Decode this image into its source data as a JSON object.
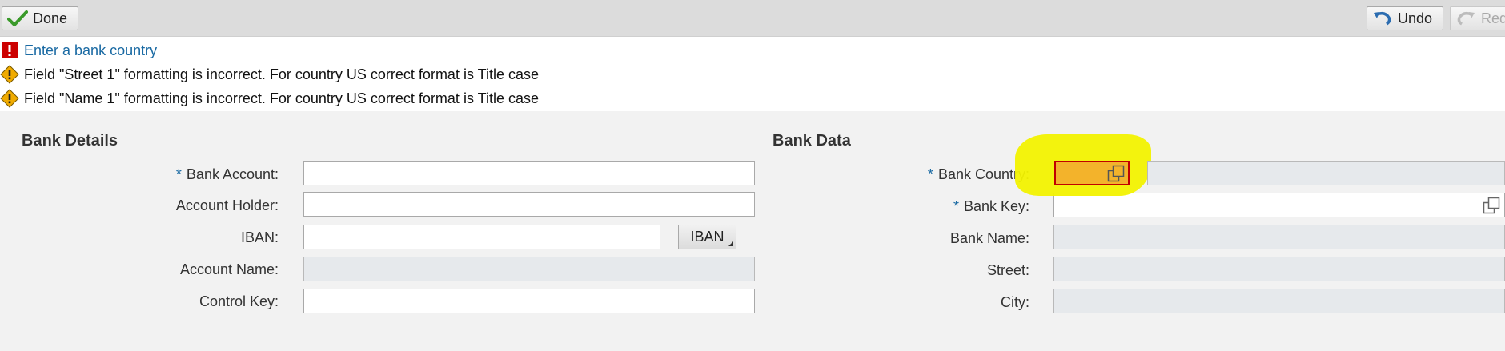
{
  "toolbar": {
    "done_label": "Done",
    "undo_label": "Undo",
    "redo_label": "Redo"
  },
  "messages": [
    {
      "type": "error",
      "text": "Enter a bank country"
    },
    {
      "type": "warning",
      "text": "Field \"Street 1\" formatting is incorrect. For country US correct format is Title case"
    },
    {
      "type": "warning",
      "text": "Field \"Name 1\" formatting is incorrect. For country US correct format is Title case"
    }
  ],
  "bank_details": {
    "title": "Bank Details",
    "fields": {
      "bank_account": {
        "label": "Bank Account:",
        "required": "*",
        "value": ""
      },
      "account_holder": {
        "label": "Account Holder:",
        "value": ""
      },
      "iban": {
        "label": "IBAN:",
        "value": "",
        "button": "IBAN"
      },
      "account_name": {
        "label": "Account Name:",
        "value": ""
      },
      "control_key": {
        "label": "Control Key:",
        "value": ""
      }
    }
  },
  "bank_data": {
    "title": "Bank Data",
    "fields": {
      "bank_country": {
        "label": "Bank Country:",
        "required": "*",
        "value": "",
        "description": ""
      },
      "bank_key": {
        "label": "Bank Key:",
        "required": "*",
        "value": ""
      },
      "bank_name": {
        "label": "Bank Name:",
        "value": ""
      },
      "street": {
        "label": "Street:",
        "value": ""
      },
      "city": {
        "label": "City:",
        "value": ""
      }
    }
  },
  "colors": {
    "error": "#cc0000",
    "warning": "#f0ab00",
    "link": "#1a6aa3",
    "highlight": "#f2f200",
    "country_field": "#f3b32b"
  },
  "icons": [
    "check-icon",
    "undo-icon",
    "redo-icon",
    "error-icon",
    "warning-icon",
    "value-help-icon"
  ]
}
